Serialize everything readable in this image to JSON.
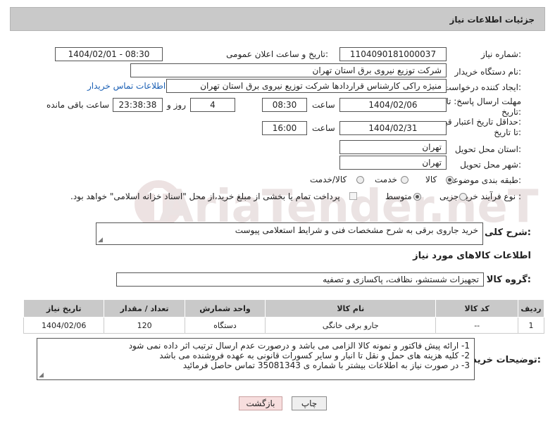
{
  "header": {
    "title": "جزئیات اطلاعات نیاز"
  },
  "watermark": {
    "text": "AriaTender.neT"
  },
  "need_number": {
    "label": "شماره نیاز:",
    "value": "1104090181000037"
  },
  "announce": {
    "label": "تاریخ و ساعت اعلان عمومی:",
    "value": "1404/02/01 - 08:30"
  },
  "buyer_org": {
    "label": "نام دستگاه خریدار:",
    "value": "شرکت توزیع نیروی برق استان تهران"
  },
  "creator": {
    "label": "ایجاد کننده درخواست:",
    "value": "منیژه راکی کارشناس قراردادها شرکت توزیع نیروی برق استان تهران",
    "contact_link": "اطلاعات تماس خریدار"
  },
  "reply_deadline": {
    "label_line1": "مهلت ارسال پاسخ: تا",
    "label_line2": "تاریخ:",
    "date": "1404/02/06",
    "time_label": "ساعت",
    "time": "08:30",
    "days": "4",
    "days_label": "روز و",
    "remaining": "23:38:38",
    "remaining_label": "ساعت باقی مانده"
  },
  "price_validity": {
    "label_line1": "حداقل تاریخ اعتبار قیمت:",
    "label_line2": "تا تاریخ:",
    "date": "1404/02/31",
    "time_label": "ساعت",
    "time": "16:00"
  },
  "province": {
    "label": "استان محل تحویل:",
    "value": "تهران"
  },
  "city": {
    "label": "شهر محل تحویل:",
    "value": "تهران"
  },
  "category": {
    "label": "طبقه بندی موضوعی:",
    "options": [
      "کالا",
      "خدمت",
      "کالا/خدمت"
    ],
    "selected": "کالا"
  },
  "purchase_type": {
    "label": "نوع فرآیند خرید :",
    "options": [
      "جزیی",
      "متوسط"
    ],
    "selected": "متوسط",
    "note": "پرداخت تمام یا بخشی از مبلغ خرید،از محل \"اسناد خزانه اسلامی\" خواهد بود."
  },
  "description": {
    "label": "شرح کلی نیاز:",
    "value": "خرید جاروی برقی به شرح مشخصات فنی و شرایط استعلامی پیوست"
  },
  "goods_section": {
    "title": "اطلاعات کالاهای مورد نیاز"
  },
  "goods_group": {
    "label": "گروه کالا:",
    "value": "تجهیزات شستشو، نظافت، پاکسازی و تصفیه"
  },
  "table": {
    "headers": [
      "ردیف",
      "کد کالا",
      "نام کالا",
      "واحد شمارش",
      "تعداد / مقدار",
      "تاریخ نیاز"
    ],
    "rows": [
      [
        "1",
        "--",
        "جارو برقی خانگی",
        "دستگاه",
        "120",
        "1404/02/06"
      ]
    ]
  },
  "buyer_notes": {
    "label": "توضیحات خریدار:",
    "lines": [
      "1- ارائه پیش فاکتور و نمونه کالا الزامی می باشد و درصورت عدم ارسال ترتیب اثر داده نمی شود",
      "2- کلیه هزینه های حمل و نقل تا انبار و سایر کسورات قانونی به عهده فروشنده می باشد",
      "3- در صورت نیاز به اطلاعات بیشتر با شماره ی 35081343 تماس حاصل فرمائید"
    ]
  },
  "buttons": {
    "print": "چاپ",
    "back": "بازگشت"
  }
}
